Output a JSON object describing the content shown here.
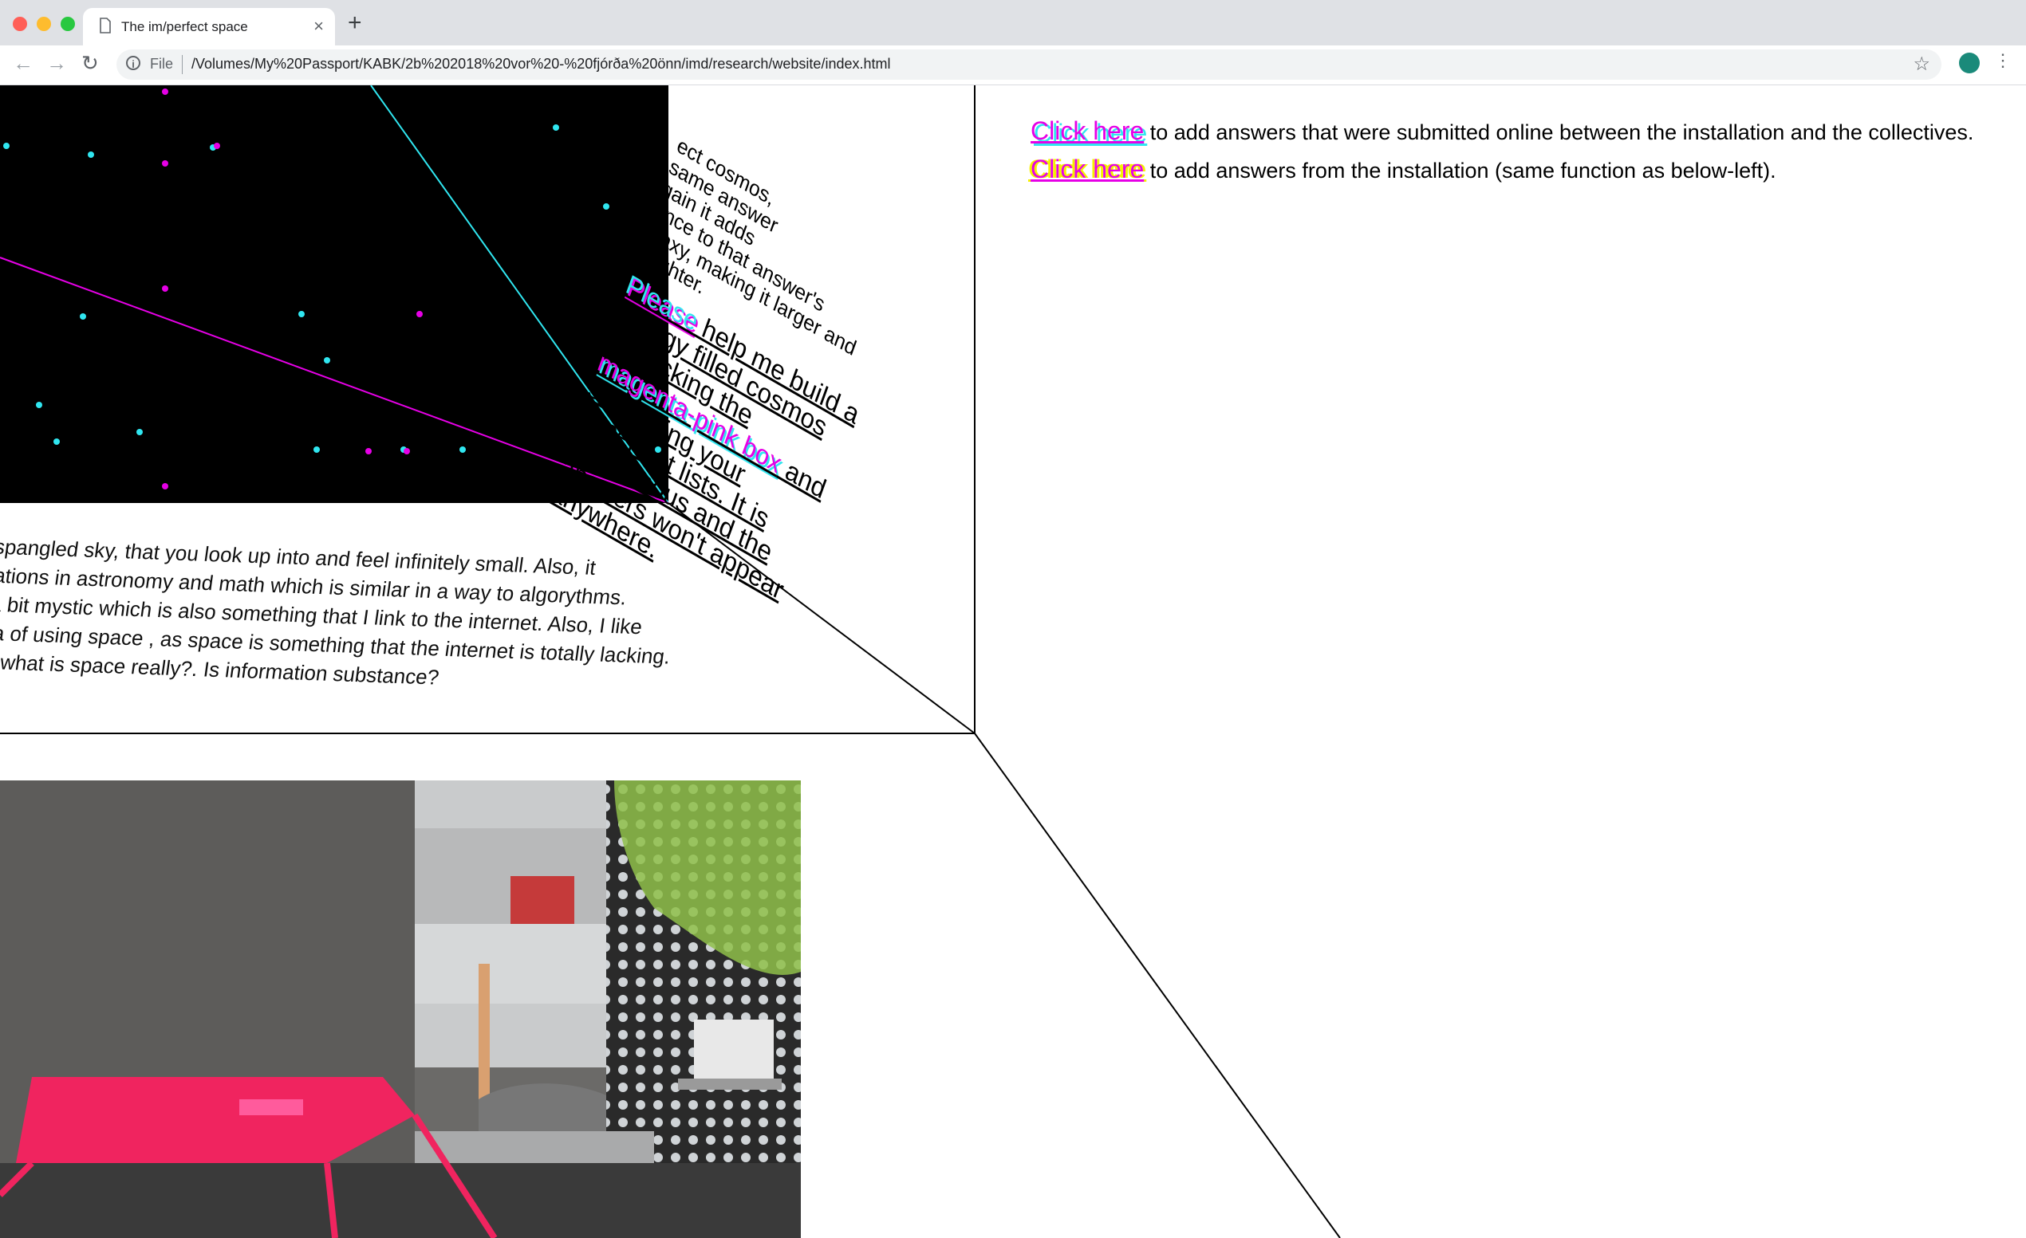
{
  "browser": {
    "tab_title": "The im/perfect space",
    "tab_close": "×",
    "new_tab": "+",
    "back": "←",
    "forward": "→",
    "reload": "↻",
    "omnibox_scheme": "File",
    "url": "/Volumes/My%20Passport/KABK/2b%202018%20vor%20-%20fjórða%20önn/imd/research/website/index.html",
    "info_glyph": "i",
    "bookmark": "☆",
    "menu": "⋮"
  },
  "page": {
    "links": [
      {
        "link": "Click here",
        "text": " to add answers that were submitted online between the installation and the collectives."
      },
      {
        "link": "Click here",
        "text": " to add answers from the installation (same function as below-left)."
      }
    ],
    "wall_top_lines": [
      "ect cosmos,",
      "same answer",
      "gain it adds",
      "ance to that answer's",
      "alaxy, making it larger and",
      "brighter."
    ],
    "wall_help": {
      "please": "Please",
      "part1": " help me build a energy filled cosmos by clicking the ",
      "magenta": "magenta-pink box",
      "part2": " and submitting your imperfect lists. It is anonymous and the answers won't appear anywhere."
    },
    "floor_lines": [
      "r spangled sky, that you look up into and feel infinitely small. Also, it",
      "elations in astronomy and math which is similar in a way to algorythms.",
      "s a bit mystic which is also something that I link to the internet. Also, I like",
      "dea of using space , as space is something that the internet is totally lacking.",
      "out what is space really?. Is information substance?"
    ]
  },
  "colors": {
    "cyan": "#30e6f0",
    "magenta": "#e600e6",
    "yellow": "#f5f000",
    "sky": "#000000"
  }
}
